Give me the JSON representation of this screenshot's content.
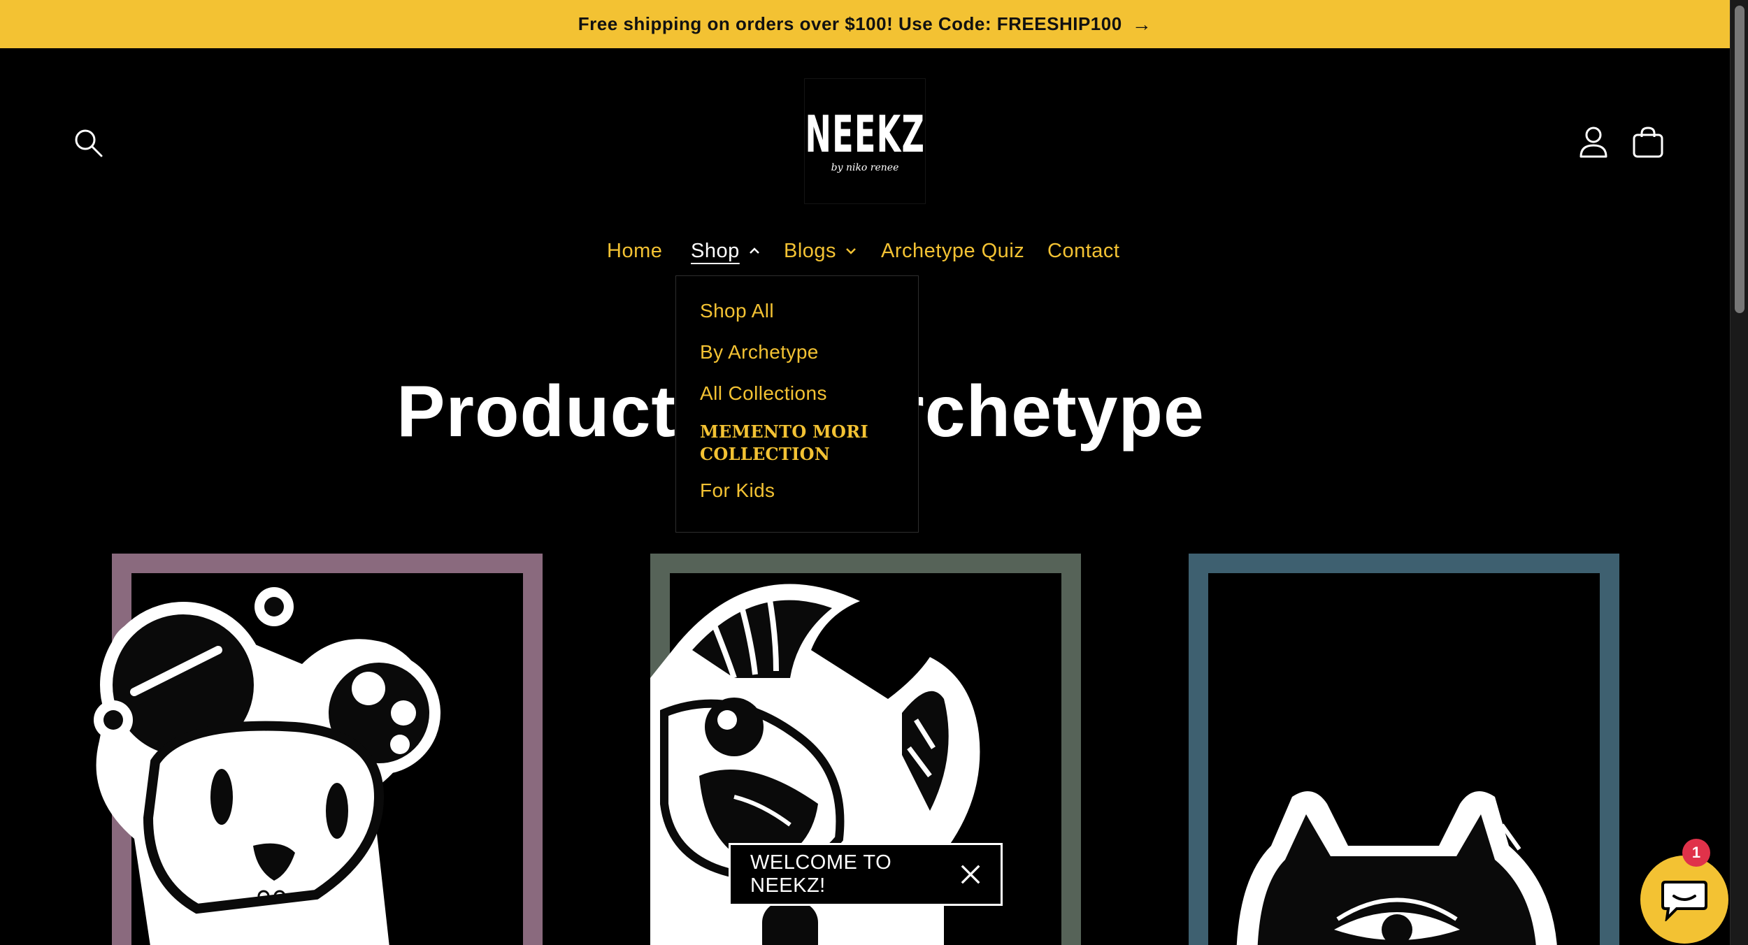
{
  "announcement": {
    "text": "Free shipping on orders over $100! Use Code: FREESHIP100",
    "arrow": "→"
  },
  "brand": {
    "logo_text": "NEEKZ",
    "tagline": "by niko renee"
  },
  "header": {
    "icons": [
      "search-icon",
      "account-icon",
      "cart-icon"
    ]
  },
  "nav": {
    "items": [
      {
        "label": "Home"
      },
      {
        "label": "Shop",
        "active": true,
        "expanded": true
      },
      {
        "label": "Blogs",
        "has_dropdown": true
      },
      {
        "label": "Archetype Quiz"
      },
      {
        "label": "Contact"
      }
    ]
  },
  "shop_menu": {
    "items": [
      {
        "label": "Shop All"
      },
      {
        "label": "By Archetype"
      },
      {
        "label": "All Collections"
      },
      {
        "label": "MEMENTO MORI COLLECTION"
      },
      {
        "label": "For Kids"
      }
    ]
  },
  "page": {
    "title": "Products by Archetype"
  },
  "products": [
    {
      "frame_color": "#8a6a7e",
      "art": "bear-character"
    },
    {
      "frame_color": "#566358",
      "art": "horned-creature"
    },
    {
      "frame_color": "#3e6070",
      "art": "cat-character"
    }
  ],
  "popup": {
    "text": "WELCOME TO NEEKZ!"
  },
  "chat": {
    "badge_count": "1"
  },
  "colors": {
    "accent": "#f3c233",
    "background": "#000000",
    "text": "#ffffff",
    "badge": "#e0324a"
  }
}
